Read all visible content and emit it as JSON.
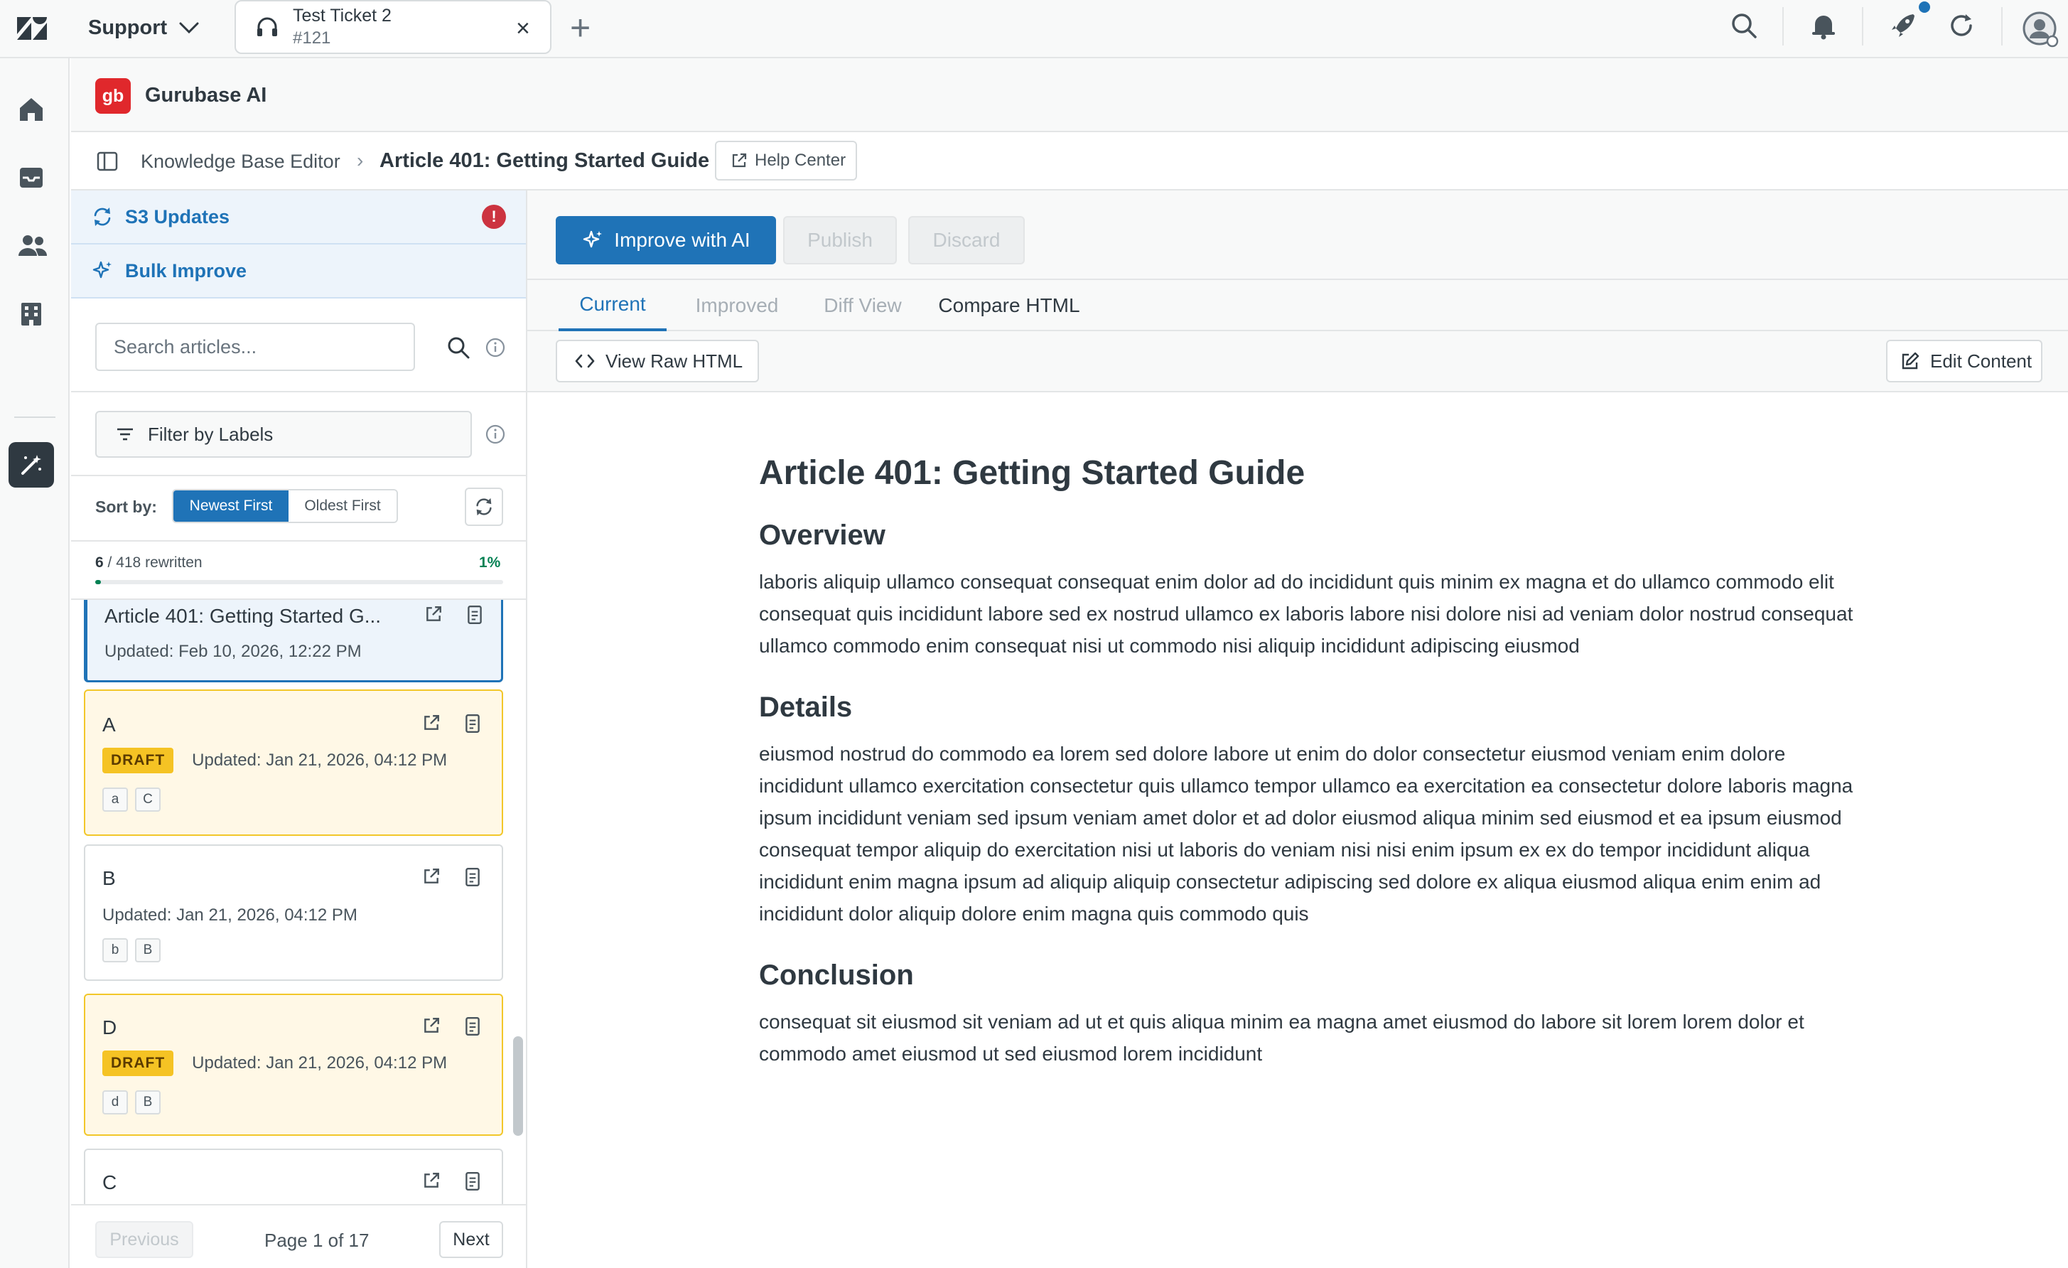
{
  "topbar": {
    "product": "Support",
    "ticket": {
      "title": "Test Ticket 2",
      "number": "#121"
    },
    "icons": [
      "search-icon",
      "bell-icon",
      "rocket-icon",
      "refresh-icon",
      "user-avatar-icon"
    ],
    "accent": "#1f73b7"
  },
  "leftnav": {
    "items": [
      "home-icon",
      "inbox-icon",
      "users-icon",
      "building-icon",
      "magic-wand-icon"
    ]
  },
  "app": {
    "logo_text": "gb",
    "name": "Gurubase AI",
    "logo_color": "#e0282c"
  },
  "breadcrumb": {
    "parent": "Knowledge Base Editor",
    "separator": "›",
    "current": "Article 401: Getting Started Guide",
    "help_center": "Help Center"
  },
  "sidebar": {
    "s3_updates": "S3 Updates",
    "s3_warning": "!",
    "bulk_improve": "Bulk Improve",
    "search_placeholder": "Search articles...",
    "filter_label": "Filter by Labels",
    "sort_label": "Sort by:",
    "sort_options": [
      "Newest First",
      "Oldest First"
    ],
    "progress": {
      "done": "6",
      "total": "/ 418 rewritten",
      "percent_label": "1%",
      "fraction": 0.014
    },
    "articles": [
      {
        "title": "Article 401: Getting Started G...",
        "updated": "Updated: Feb 10, 2026, 12:22 PM",
        "status": "",
        "tags": []
      },
      {
        "title": "A",
        "updated": "Updated: Jan 21, 2026, 04:12 PM",
        "status": "DRAFT",
        "tags": [
          "a",
          "C"
        ]
      },
      {
        "title": "B",
        "updated": "Updated: Jan 21, 2026, 04:12 PM",
        "status": "",
        "tags": [
          "b",
          "B"
        ]
      },
      {
        "title": "D",
        "updated": "Updated: Jan 21, 2026, 04:12 PM",
        "status": "DRAFT",
        "tags": [
          "d",
          "B"
        ]
      },
      {
        "title": "C",
        "updated": "",
        "status": "",
        "tags": []
      }
    ],
    "pager": {
      "previous": "Previous",
      "info": "Page 1 of 17",
      "next": "Next"
    }
  },
  "main": {
    "improve": "Improve with AI",
    "publish": "Publish",
    "discard": "Discard",
    "tabs": [
      "Current",
      "Improved",
      "Diff View",
      "Compare HTML"
    ],
    "active_tab": "Current",
    "view_raw": "View Raw HTML",
    "edit_content": "Edit Content"
  },
  "article": {
    "title": "Article 401: Getting Started Guide",
    "sections": [
      {
        "heading": "Overview",
        "body": "laboris aliquip ullamco consequat consequat enim dolor ad do incididunt quis minim ex magna et do ullamco commodo elit consequat quis incididunt labore sed ex nostrud ullamco ex laboris labore nisi dolore nisi ad veniam dolor nostrud consequat ullamco commodo enim consequat nisi ut commodo nisi aliquip incididunt adipiscing eiusmod"
      },
      {
        "heading": "Details",
        "body": "eiusmod nostrud do commodo ea lorem sed dolore labore ut enim do dolor consectetur eiusmod veniam enim dolore incididunt ullamco exercitation consectetur quis ullamco tempor ullamco ea exercitation ea consectetur dolore laboris magna ipsum incididunt veniam sed ipsum veniam amet dolor et ad dolor eiusmod aliqua minim sed eiusmod et ea ipsum eiusmod consequat tempor aliquip do exercitation nisi ut laboris do veniam nisi nisi enim ipsum ex ex do tempor incididunt aliqua incididunt enim magna ipsum ad aliquip aliquip consectetur adipiscing sed dolore ex aliqua eiusmod aliqua enim enim ad incididunt dolor aliquip dolore enim magna quis commodo quis"
      },
      {
        "heading": "Conclusion",
        "body": "consequat sit eiusmod sit veniam ad ut et quis aliqua minim ea magna amet eiusmod do labore sit lorem lorem dolor et commodo amet eiusmod ut sed eiusmod lorem incididunt"
      }
    ]
  }
}
